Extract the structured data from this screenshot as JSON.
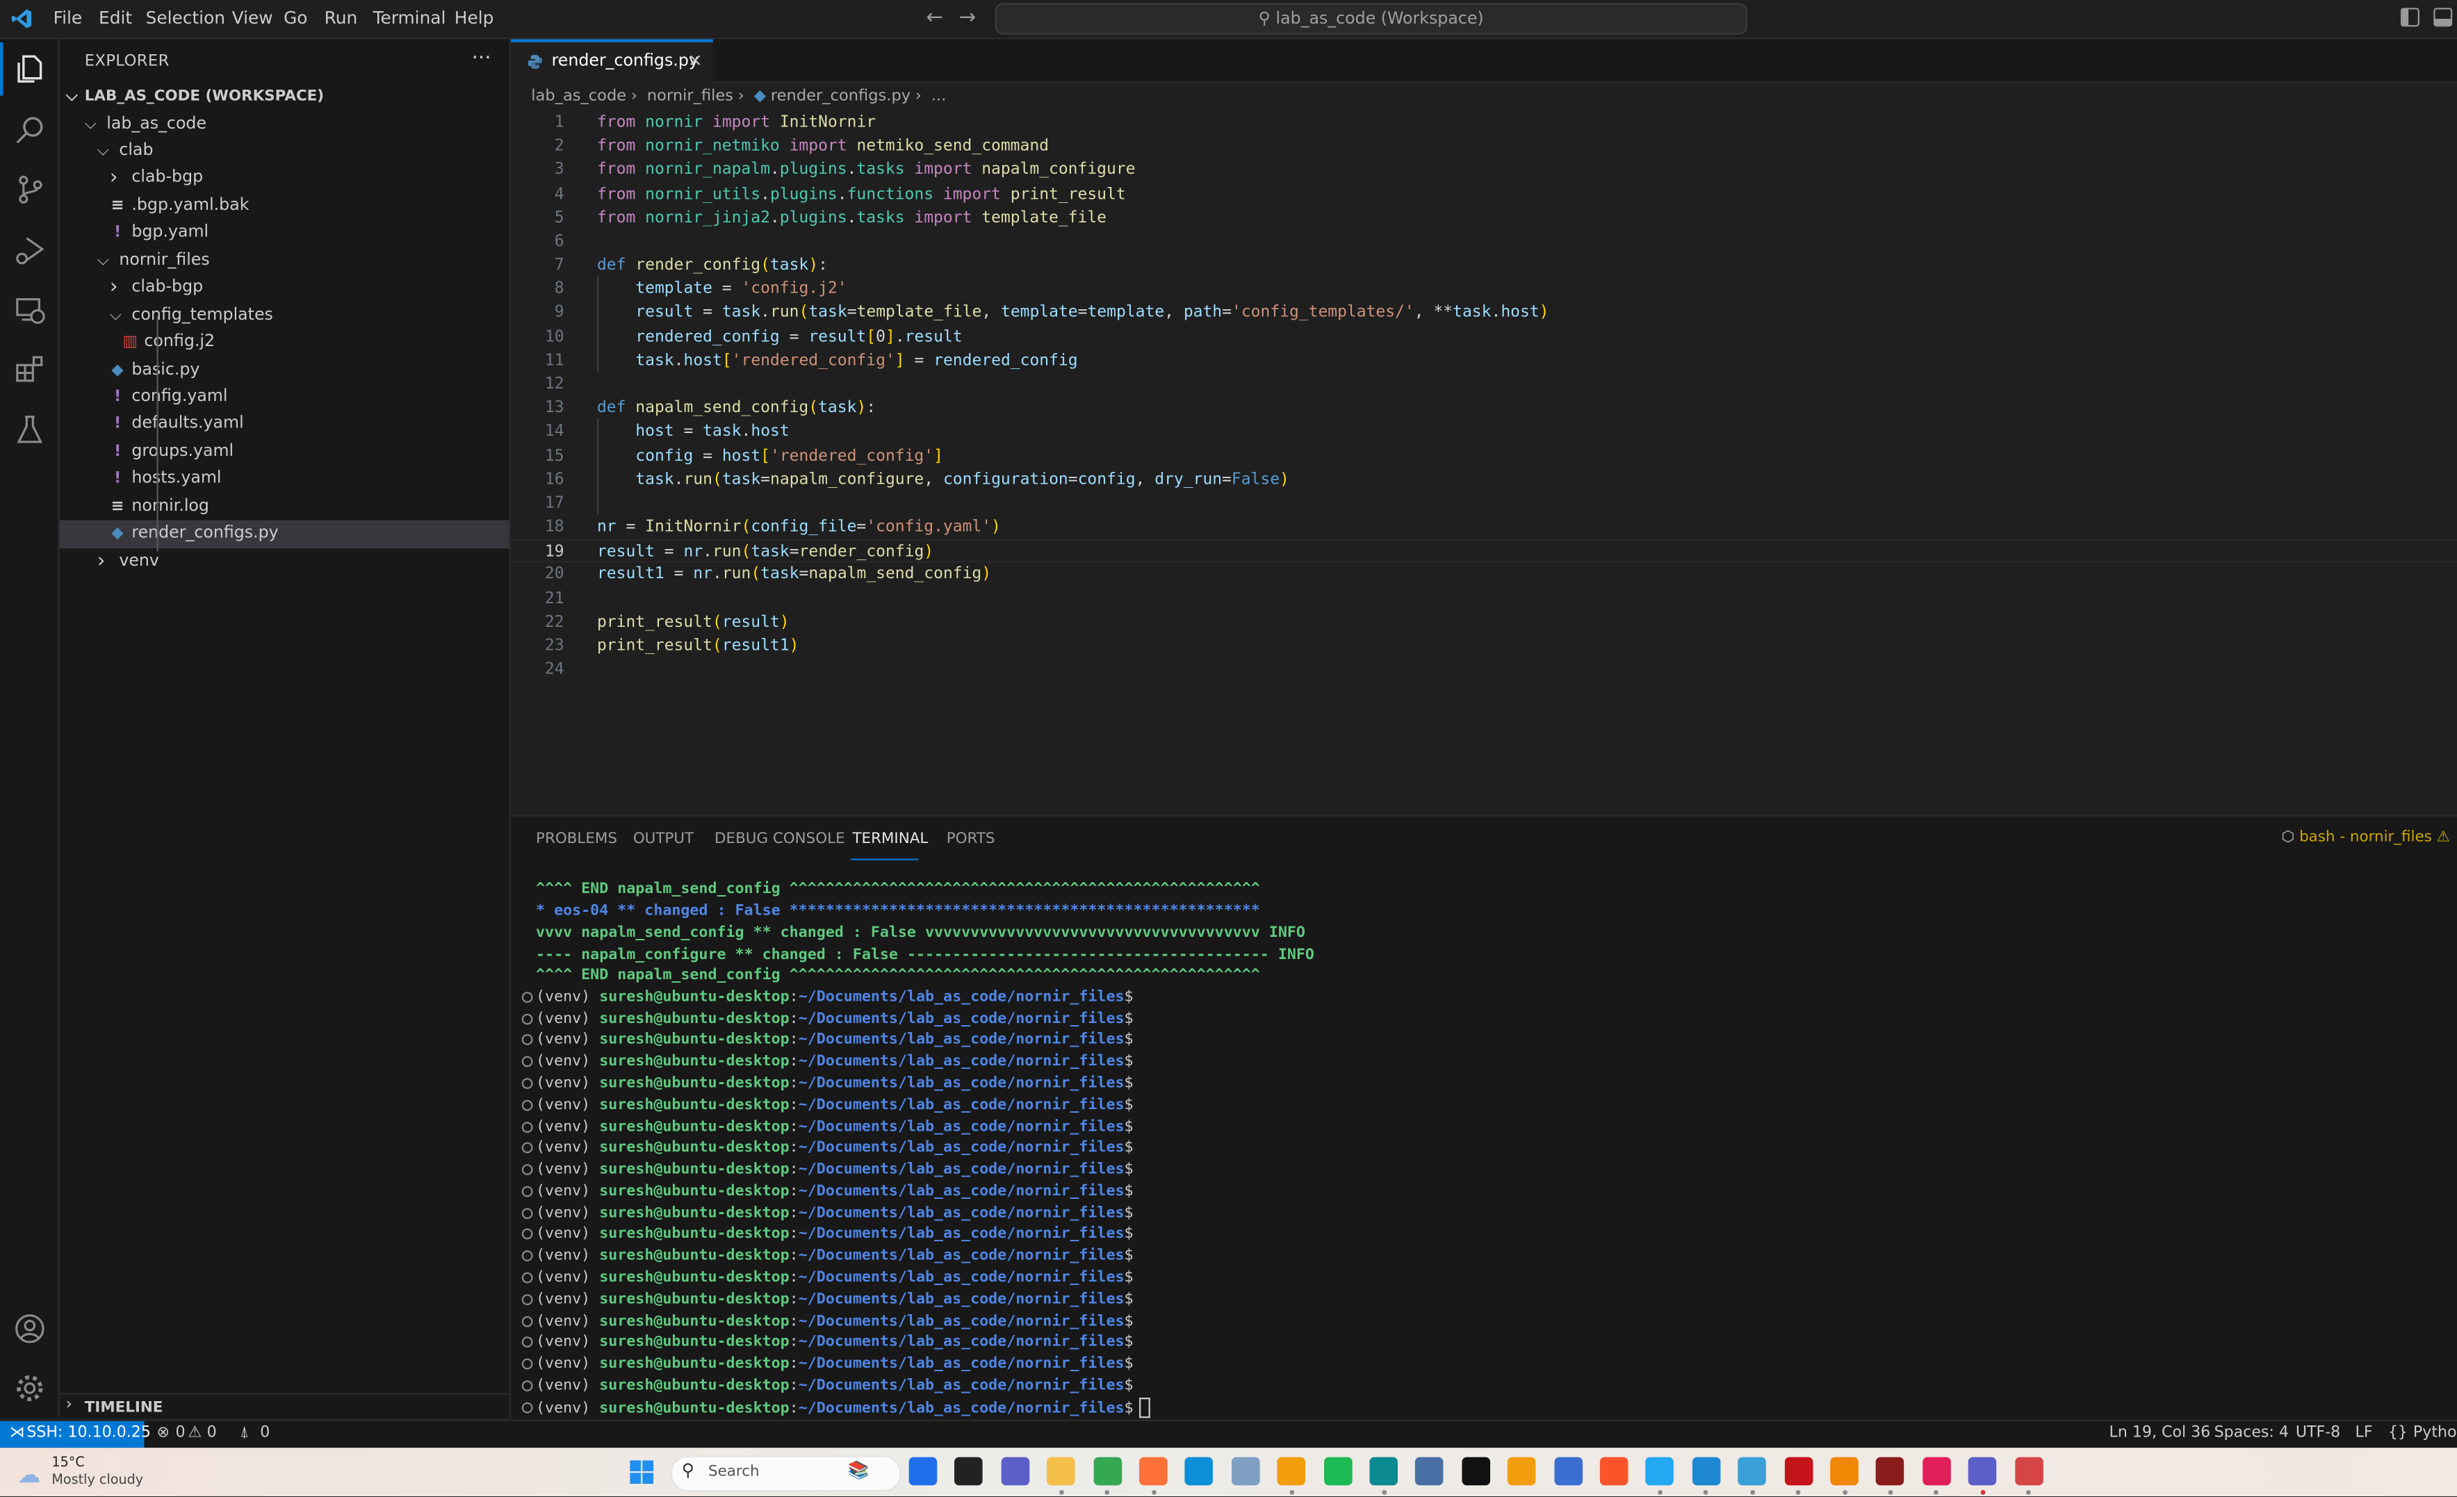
{
  "titlebar": {
    "menu": [
      "File",
      "Edit",
      "Selection",
      "View",
      "Go",
      "Run",
      "Terminal",
      "Help"
    ],
    "command_center": "lab_as_code (Workspace)",
    "icons": [
      "vscode-logo-icon",
      "back-arrow-icon",
      "forward-arrow-icon",
      "search-icon",
      "toggle-primary-sidebar-icon",
      "toggle-panel-icon"
    ]
  },
  "activity_bar": {
    "items": [
      "explorer",
      "search",
      "source-control",
      "run-and-debug",
      "remote-explorer",
      "extensions",
      "testing"
    ],
    "bottom": [
      "accounts",
      "manage"
    ]
  },
  "sidebar": {
    "title": "EXPLORER",
    "more": "···",
    "workspace": "LAB_AS_CODE (WORKSPACE)",
    "tree": [
      {
        "label": "lab_as_code",
        "type": "folder",
        "expanded": true,
        "depth": 0
      },
      {
        "label": "clab",
        "type": "folder",
        "expanded": true,
        "depth": 1
      },
      {
        "label": "clab-bgp",
        "type": "folder",
        "expanded": false,
        "depth": 2
      },
      {
        "label": ".bgp.yaml.bak",
        "type": "text",
        "depth": 2
      },
      {
        "label": "bgp.yaml",
        "type": "yaml",
        "depth": 2
      },
      {
        "label": "nornir_files",
        "type": "folder",
        "expanded": true,
        "depth": 1
      },
      {
        "label": "clab-bgp",
        "type": "folder",
        "expanded": false,
        "depth": 2
      },
      {
        "label": "config_templates",
        "type": "folder",
        "expanded": true,
        "depth": 2
      },
      {
        "label": "config.j2",
        "type": "jinja",
        "depth": 3
      },
      {
        "label": "basic.py",
        "type": "python",
        "depth": 2
      },
      {
        "label": "config.yaml",
        "type": "yaml",
        "depth": 2
      },
      {
        "label": "defaults.yaml",
        "type": "yaml",
        "depth": 2
      },
      {
        "label": "groups.yaml",
        "type": "yaml",
        "depth": 2
      },
      {
        "label": "hosts.yaml",
        "type": "yaml",
        "depth": 2
      },
      {
        "label": "nornir.log",
        "type": "text",
        "depth": 2
      },
      {
        "label": "render_configs.py",
        "type": "python",
        "depth": 2,
        "selected": true
      },
      {
        "label": "venv",
        "type": "folder",
        "expanded": false,
        "depth": 1
      }
    ],
    "timeline": "TIMELINE"
  },
  "editor": {
    "tab": {
      "label": "render_configs.py",
      "close": "×"
    },
    "breadcrumb": [
      "lab_as_code",
      "nornir_files",
      "render_configs.py",
      "..."
    ],
    "current_line": 19,
    "lines": [
      "from nornir import InitNornir",
      "from nornir_netmiko import netmiko_send_command",
      "from nornir_napalm.plugins.tasks import napalm_configure",
      "from nornir_utils.plugins.functions import print_result",
      "from nornir_jinja2.plugins.tasks import template_file",
      "",
      "def render_config(task):",
      "    template = 'config.j2'",
      "    result = task.run(task=template_file, template=template, path='config_templates/', **task.host)",
      "    rendered_config = result[0].result",
      "    task.host['rendered_config'] = rendered_config",
      "",
      "def napalm_send_config(task):",
      "    host = task.host",
      "    config = host['rendered_config']",
      "    task.run(task=napalm_configure, configuration=config, dry_run=False)",
      "",
      "nr = InitNornir(config_file='config.yaml')",
      "result = nr.run(task=render_config)",
      "result1 = nr.run(task=napalm_send_config)",
      "",
      "print_result(result)",
      "print_result(result1)",
      ""
    ]
  },
  "panel": {
    "tabs": [
      "PROBLEMS",
      "OUTPUT",
      "DEBUG CONSOLE",
      "TERMINAL",
      "PORTS"
    ],
    "active_tab": "TERMINAL",
    "terminal_name": "bash - nornir_files",
    "terminal_output": [
      {
        "text": "^^^^ END napalm_send_config ^^^^^^^^^^^^^^^^^^^^^^^^^^^^^^^^^^^^^^^^^^^^^^^^^^^^",
        "color": "green"
      },
      {
        "text": "* eos-04 ** changed : False ****************************************************",
        "color": "blue"
      },
      {
        "text": "vvvv napalm_send_config ** changed : False vvvvvvvvvvvvvvvvvvvvvvvvvvvvvvvvvvvvv INFO",
        "color": "green"
      },
      {
        "text": "---- napalm_configure ** changed : False ---------------------------------------- INFO",
        "color": "green"
      },
      {
        "text": "^^^^ END napalm_send_config ^^^^^^^^^^^^^^^^^^^^^^^^^^^^^^^^^^^^^^^^^^^^^^^^^^^^",
        "color": "green"
      }
    ],
    "prompt": {
      "venv": "(venv) ",
      "user_host": "suresh@ubuntu-desktop",
      "colon": ":",
      "path": "~/Documents/lab_as_code/nornir_files",
      "symbol": "$"
    },
    "prompt_count": 20
  },
  "statusbar": {
    "remote": "SSH: 10.10.0.25",
    "errors": "0",
    "warnings": "0",
    "ports": "0",
    "position": "Ln 19, Col 36",
    "indent": "Spaces: 4",
    "encoding": "UTF-8",
    "eol": "LF",
    "language": "Python"
  },
  "taskbar": {
    "weather_temp": "15°C",
    "weather_desc": "Mostly cloudy",
    "search_placeholder": "Search",
    "apps": [
      "copilot",
      "terminal-window",
      "teams",
      "file-explorer",
      "chrome",
      "firefox",
      "edge",
      "resource-monitor",
      "sublime-text",
      "spotify",
      "eset",
      "rdp-lock",
      "cmd",
      "powershell-orange",
      "remote-desktop",
      "brave",
      "vscode",
      "virtualbox",
      "notepad",
      "acrobat",
      "drawio",
      "puzzle-64",
      "slack",
      "teams-new",
      "snipping-tool"
    ],
    "colors": [
      "#1f6feb",
      "#222222",
      "#5b5fc7",
      "#f5c04a",
      "#34a853",
      "#ff7139",
      "#0c8fd6",
      "#7f9fc3",
      "#f29d0c",
      "#1db954",
      "#0b8a8f",
      "#4a6fa5",
      "#111111",
      "#f29d0c",
      "#3a6fd0",
      "#fb542b",
      "#23a9f2",
      "#1e88d2",
      "#3aa0d8",
      "#c5131a",
      "#f08705",
      "#8b1c1c",
      "#e01e5a",
      "#5b5fc7",
      "#d64545"
    ]
  }
}
